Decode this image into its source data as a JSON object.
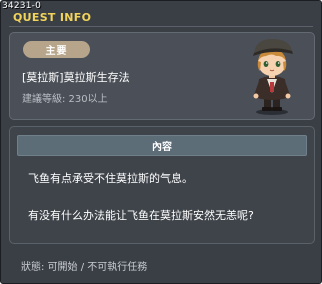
{
  "window": {
    "quest_id": "34231-0",
    "title": "QUEST INFO"
  },
  "quest": {
    "category_badge": "主要",
    "name": "[莫拉斯]莫拉斯生存法",
    "level_requirement": "建議等級: 230以上",
    "npc_icon": "npc-portrait-icon"
  },
  "content": {
    "header": "內容",
    "lines": [
      "飞鱼有点承受不住莫拉斯的气息。",
      "有没有什么办法能让飞鱼在莫拉斯安然无恙呢?"
    ]
  },
  "status": {
    "text": "狀態:  可開始  /  不可執行任務"
  },
  "colors": {
    "window_bg": "#3a3f46",
    "title": "#f2d45a",
    "badge": "#b6a58a",
    "content_header": "#5d6d78"
  }
}
